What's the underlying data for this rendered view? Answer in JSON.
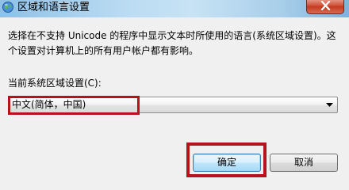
{
  "window": {
    "title": "区域和语言设置",
    "app_icon": "globe-icon",
    "close_icon": "close-icon"
  },
  "dialog": {
    "description_lines": [
      "选择在不支持 Unicode 的程序中显示文本时所使用的语言(系统区域设置)。这",
      "个设置对计算机上的所有用户帐户都有影响。"
    ],
    "locale_label": "当前系统区域设置(C):",
    "locale_value": "中文(简体，中国)"
  },
  "buttons": {
    "ok_label": "确定",
    "cancel_label": "取消"
  },
  "colors": {
    "highlight": "#b5121b",
    "close_button": "#c23c22"
  }
}
